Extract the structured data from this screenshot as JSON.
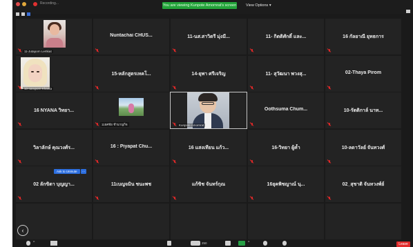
{
  "window": {
    "title": "Recording..."
  },
  "banner": {
    "text": "You are viewing Kunpote Amornrat's screen"
  },
  "view_options": {
    "label": "View Options ▾"
  },
  "tiles": [
    {
      "name": "",
      "label": "11-Jutaporn Lertkiat",
      "video": "a"
    },
    {
      "name": "Nuntachai  CHUS...",
      "label": "",
      "video": ""
    },
    {
      "name": "11-นส.สาวิตรี มุ่งมี...",
      "label": "",
      "video": ""
    },
    {
      "name": "11- กิตติศักดิ์ และ...",
      "label": "",
      "video": ""
    },
    {
      "name": "16 กัลยาณี ยุทธการ",
      "label": "",
      "video": ""
    },
    {
      "name": "",
      "label": "10-naruporn Khanta",
      "video": "b"
    },
    {
      "name": "15-หลักสูตรเทคโ...",
      "label": "",
      "video": ""
    },
    {
      "name": "14-ยุพา ศรีเจริญ",
      "label": "",
      "video": ""
    },
    {
      "name": "11- สุวัฒนา พวงสุ...",
      "label": "",
      "video": ""
    },
    {
      "name": "02-Thaya Pirom",
      "label": "",
      "video": ""
    },
    {
      "name": "16  NYANA วิทยา...",
      "label": "",
      "video": ""
    },
    {
      "name": "",
      "label": "11ยศชัย ชำนาญกิจ",
      "video": "c"
    },
    {
      "name": "",
      "label": "Kunpote Amornrat",
      "video": "d"
    },
    {
      "name": "Oothsuma  Chum...",
      "label": "",
      "video": ""
    },
    {
      "name": "10-รัตติกาล์ นาท...",
      "label": "",
      "video": ""
    },
    {
      "name": "วิลาลักษ์ คุณวงศ์ร...",
      "label": "",
      "video": ""
    },
    {
      "name": "16 : Piyapat Chu...",
      "label": "",
      "video": ""
    },
    {
      "name": "16 แสงเทียน แก้ว...",
      "label": "",
      "video": ""
    },
    {
      "name": "16-วิทยา ผู้ค้ำ",
      "label": "",
      "video": ""
    },
    {
      "name": "10-ลดาวัลย์ จันทวงศ์",
      "label": "",
      "video": ""
    },
    {
      "name": "02 ลักขิตา บุญญา...",
      "label": "",
      "video": ""
    },
    {
      "name": "11เบญจมิน ชนะพช",
      "label": "",
      "video": ""
    },
    {
      "name": "แก้ขิช จันทร์กุณ",
      "label": "",
      "video": ""
    },
    {
      "name": "16ยุคพิชญาณ์ นุ...",
      "label": "",
      "video": ""
    },
    {
      "name": "02_สุชาติ จันทวงพ์ย์",
      "label": "",
      "video": ""
    },
    {
      "name": "",
      "label": "",
      "video": ""
    },
    {
      "name": "",
      "label": "",
      "video": ""
    },
    {
      "name": "",
      "label": "",
      "video": ""
    },
    {
      "name": "",
      "label": "",
      "video": ""
    },
    {
      "name": "",
      "label": "",
      "video": ""
    }
  ],
  "unmute": {
    "label": "Ask to Unmute",
    "more": "···"
  },
  "prev_page": {
    "icon": "‹"
  },
  "toolbar": {
    "participants_count": "250",
    "leave_label": "Leave",
    "caret": "^"
  },
  "colors": {
    "banner": "#23a33a",
    "muted": "#e02828",
    "unmute": "#2d6fe0",
    "leave": "#e02b2b",
    "share": "#27a046"
  }
}
